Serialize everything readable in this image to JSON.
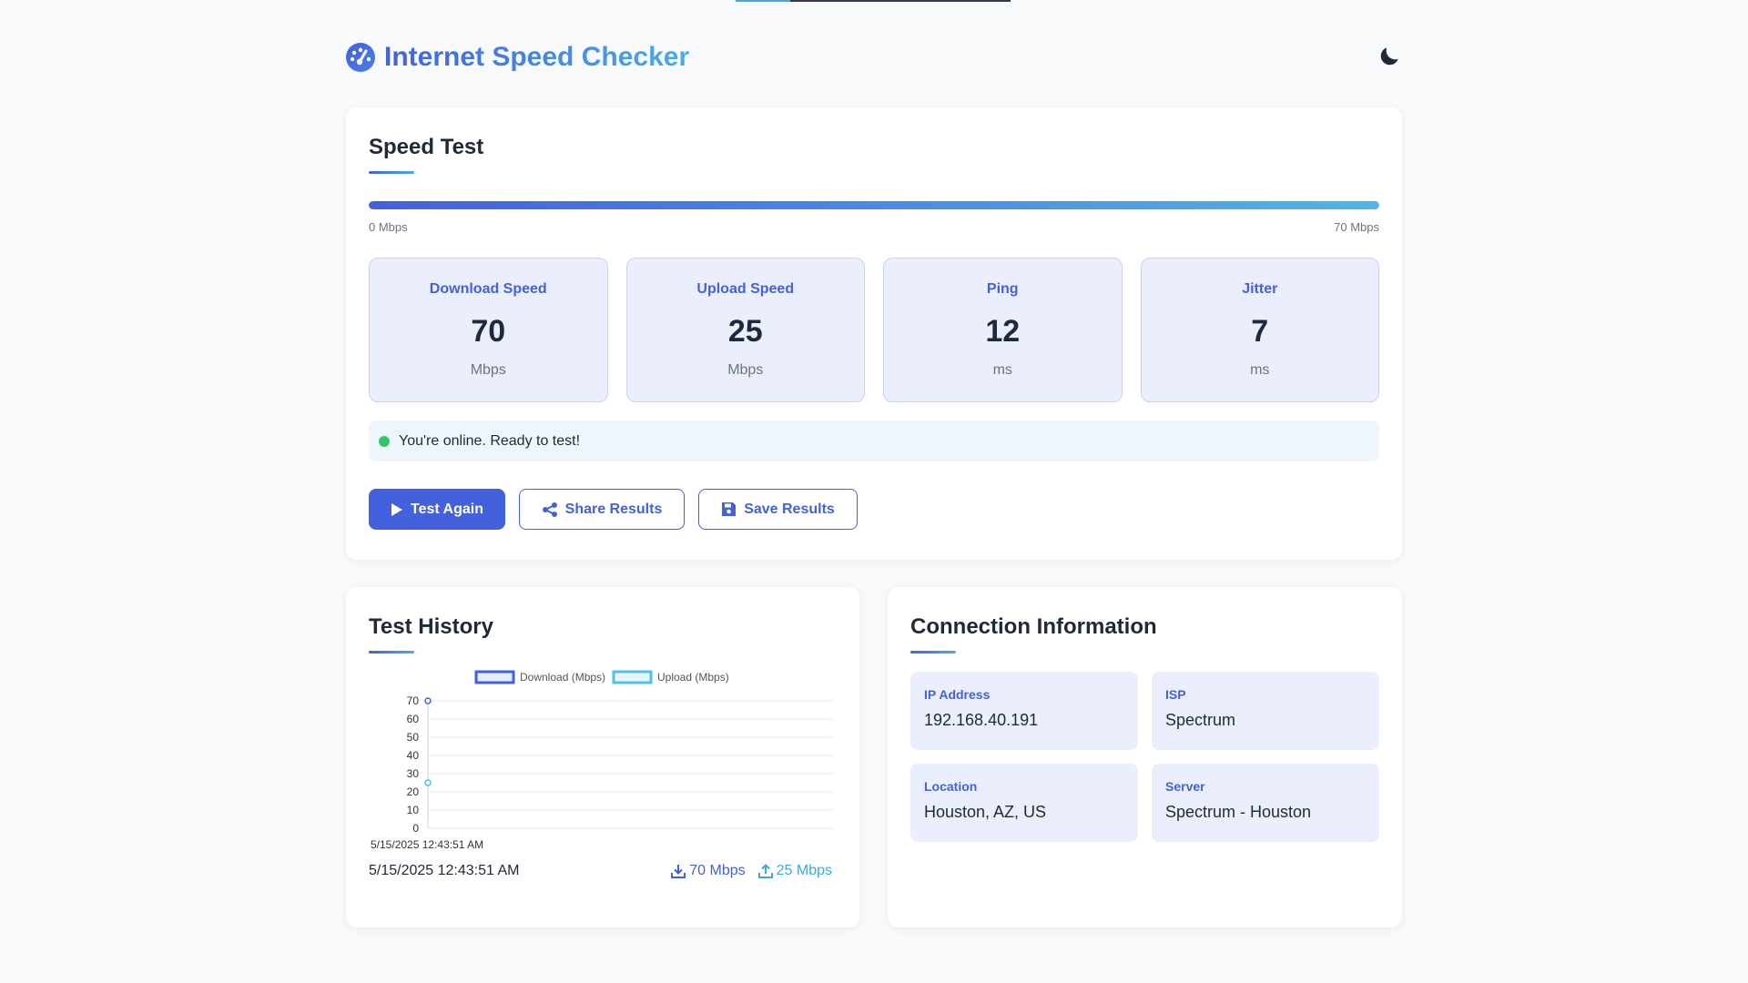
{
  "app": {
    "title": "Internet Speed Checker",
    "icons": {
      "logo": "speedometer-icon",
      "theme": "moon-icon"
    }
  },
  "speed_test": {
    "title": "Speed Test",
    "progress_fraction": 1.0,
    "scale_min_label": "0 Mbps",
    "scale_max_label": "70 Mbps",
    "metrics": [
      {
        "label": "Download Speed",
        "value": "70",
        "unit": "Mbps"
      },
      {
        "label": "Upload Speed",
        "value": "25",
        "unit": "Mbps"
      },
      {
        "label": "Ping",
        "value": "12",
        "unit": "ms"
      },
      {
        "label": "Jitter",
        "value": "7",
        "unit": "ms"
      }
    ],
    "status": {
      "text": "You're online. Ready to test!",
      "color": "#34c76a"
    },
    "buttons": {
      "test_again": "Test Again",
      "share": "Share Results",
      "save": "Save Results"
    }
  },
  "history": {
    "title": "Test History",
    "entries": [
      {
        "date": "5/15/2025 12:43:51 AM",
        "download": "70 Mbps",
        "upload": "25 Mbps"
      }
    ]
  },
  "chart_data": {
    "type": "line",
    "x": [
      "5/15/2025 12:43:51 AM"
    ],
    "series": [
      {
        "name": "Download (Mbps)",
        "values": [
          70
        ],
        "color": "#4360dd"
      },
      {
        "name": "Upload (Mbps)",
        "values": [
          25
        ],
        "color": "#4fc1e9"
      }
    ],
    "ylim": [
      0,
      70
    ],
    "yticks": [
      0,
      10,
      20,
      30,
      40,
      50,
      60,
      70
    ],
    "grid": true,
    "legend": "top-center"
  },
  "connection": {
    "title": "Connection Information",
    "items": [
      {
        "label": "IP Address",
        "value": "192.168.40.191"
      },
      {
        "label": "ISP",
        "value": "Spectrum"
      },
      {
        "label": "Location",
        "value": "Houston, AZ, US"
      },
      {
        "label": "Server",
        "value": "Spectrum - Houston"
      }
    ]
  },
  "colors": {
    "accent": "#4360dd",
    "accent_light": "#4aace6",
    "metric_bg": "#ebeffd",
    "status_bg": "#eef6fc"
  }
}
